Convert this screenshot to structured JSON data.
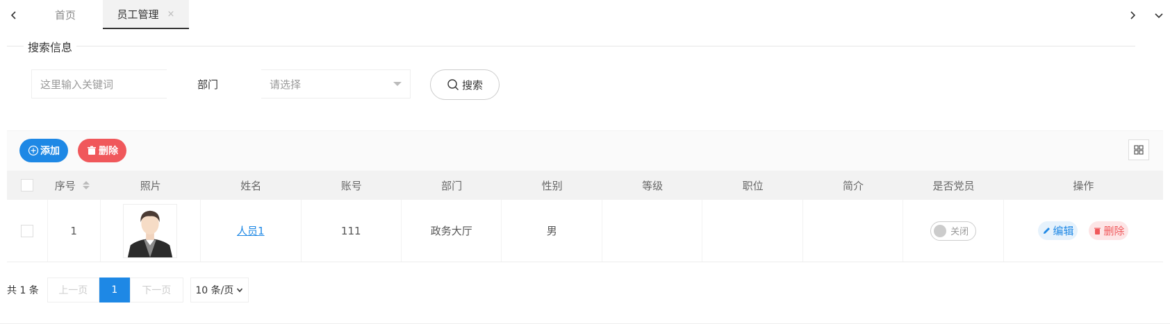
{
  "tabs": [
    {
      "label": "首页",
      "active": false
    },
    {
      "label": "员工管理",
      "active": true,
      "close": "×"
    }
  ],
  "search": {
    "legend": "搜索信息",
    "keyword_placeholder": "这里输入关键词",
    "dept_label": "部门",
    "dept_placeholder": "请选择",
    "search_label": "搜索"
  },
  "toolbar": {
    "add_label": "添加",
    "delete_label": "删除"
  },
  "table": {
    "headers": [
      "序号",
      "照片",
      "姓名",
      "账号",
      "部门",
      "性别",
      "等级",
      "职位",
      "简介",
      "是否党员",
      "操作"
    ],
    "rows": [
      {
        "index": "1",
        "name": "人员1",
        "account": "111",
        "department": "政务大厅",
        "gender": "男",
        "level": "",
        "position": "",
        "intro": "",
        "party_member": "关闭",
        "edit": "编辑",
        "delete": "删除"
      }
    ]
  },
  "pagination": {
    "total": "共 1 条",
    "prev": "上一页",
    "current": "1",
    "next": "下一页",
    "page_size": "10 条/页"
  },
  "colors": {
    "primary": "#1e88e5",
    "danger": "#f0585b"
  }
}
